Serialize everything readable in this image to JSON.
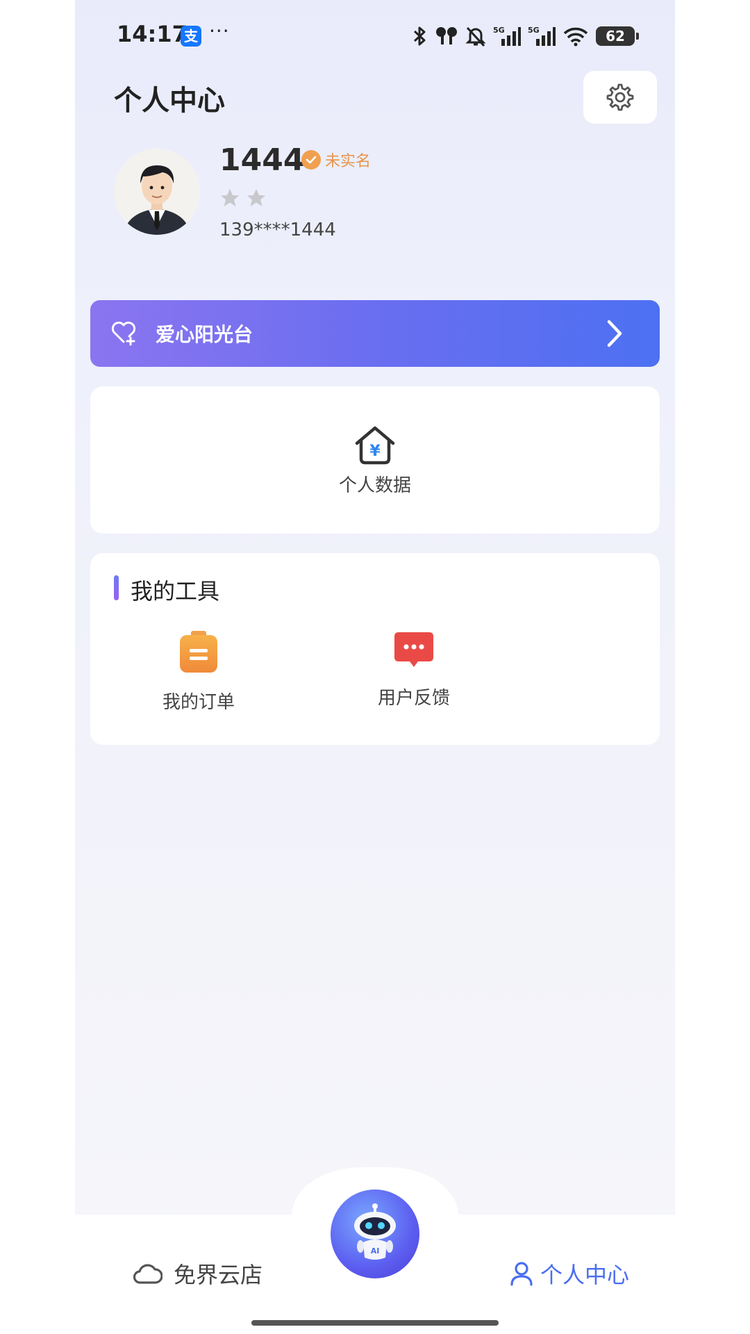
{
  "status_bar": {
    "time": "14:17",
    "alipay_glyph": "支",
    "more": "···",
    "battery": "62",
    "icons": [
      "bluetooth-icon",
      "earbuds-icon",
      "mute-icon",
      "signal-5g-icon",
      "signal-5g-icon",
      "wifi-icon",
      "battery-icon"
    ]
  },
  "header": {
    "title": "个人中心"
  },
  "profile": {
    "name": "1444",
    "verify_status": "未实名",
    "stars": 2,
    "phone": "139****1444"
  },
  "banner": {
    "label": "爱心阳光台"
  },
  "data_card": {
    "label": "个人数据"
  },
  "tools": {
    "title": "我的工具",
    "items": [
      {
        "label": "我的订单",
        "icon": "order-icon"
      },
      {
        "label": "用户反馈",
        "icon": "feedback-icon"
      }
    ]
  },
  "nav": {
    "left_label": "免界云店",
    "right_label": "个人中心",
    "center_icon": "ai-robot-icon"
  },
  "colors": {
    "accent": "#4a6ef0",
    "banner_start": "#8b75f0",
    "banner_end": "#4d70f2",
    "verify": "#e8944a"
  }
}
